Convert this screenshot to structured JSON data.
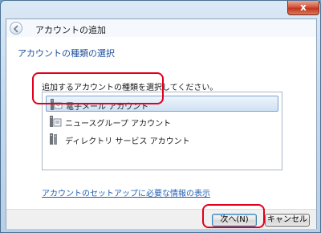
{
  "window": {
    "title": "アカウントの追加",
    "close_glyph": "x"
  },
  "section_heading": "アカウントの種類の選択",
  "instruction": "追加するアカウントの種類を選択してください。",
  "account_types": [
    {
      "label": "電子メール アカウント",
      "icon": "email-account-icon",
      "selected": true
    },
    {
      "label": "ニュースグループ アカウント",
      "icon": "newsgroup-account-icon",
      "selected": false
    },
    {
      "label": "ディレクトリ サービス アカウント",
      "icon": "directory-service-icon",
      "selected": false
    }
  ],
  "help_link": "アカウントのセットアップに必要な情報の表示",
  "buttons": {
    "next": "次へ(N)",
    "cancel": "キャンセル"
  },
  "colors": {
    "highlight": "#e0001b",
    "heading": "#1d4f9c",
    "link": "#1f5fb4"
  }
}
